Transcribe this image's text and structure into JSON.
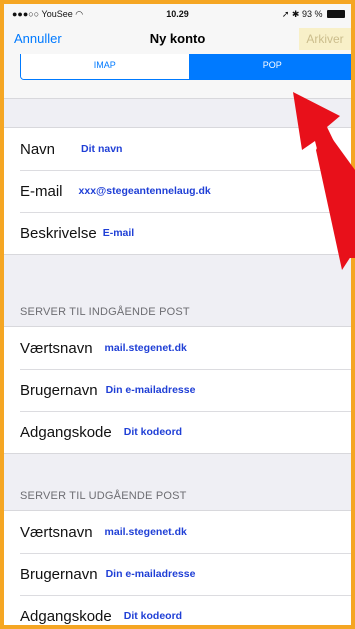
{
  "status_bar": {
    "carrier": "YouSee",
    "time": "10.29",
    "battery": "93 %"
  },
  "nav": {
    "cancel_label": "Annuller",
    "title": "Ny konto",
    "save_label": "Arkiver"
  },
  "segments": {
    "imap_label": "IMAP",
    "pop_label": "POP",
    "selected": "POP"
  },
  "account_fields": [
    {
      "label": "Navn",
      "value": "Dit navn"
    },
    {
      "label": "E-mail",
      "value": "xxx@stegeantennelaug.dk"
    },
    {
      "label": "Beskrivelse",
      "value": "E-mail"
    }
  ],
  "incoming": {
    "header": "SERVER TIL INDGÅENDE POST",
    "fields": [
      {
        "label": "Værtsnavn",
        "value": "mail.stegenet.dk"
      },
      {
        "label": "Brugernavn",
        "value": "Din e-mailadresse"
      },
      {
        "label": "Adgangskode",
        "value": "Dit kodeord"
      }
    ]
  },
  "outgoing": {
    "header": "SERVER TIL UDGÅENDE POST",
    "fields": [
      {
        "label": "Værtsnavn",
        "value": "mail.stegenet.dk"
      },
      {
        "label": "Brugernavn",
        "value": "Din e-mailadresse"
      },
      {
        "label": "Adgangskode",
        "value": "Dit kodeord"
      }
    ]
  },
  "colors": {
    "border_frame": "#f5a623",
    "ios_blue": "#007aff",
    "value_blue": "#1f3fd6",
    "arrow_red": "#e8101a"
  }
}
